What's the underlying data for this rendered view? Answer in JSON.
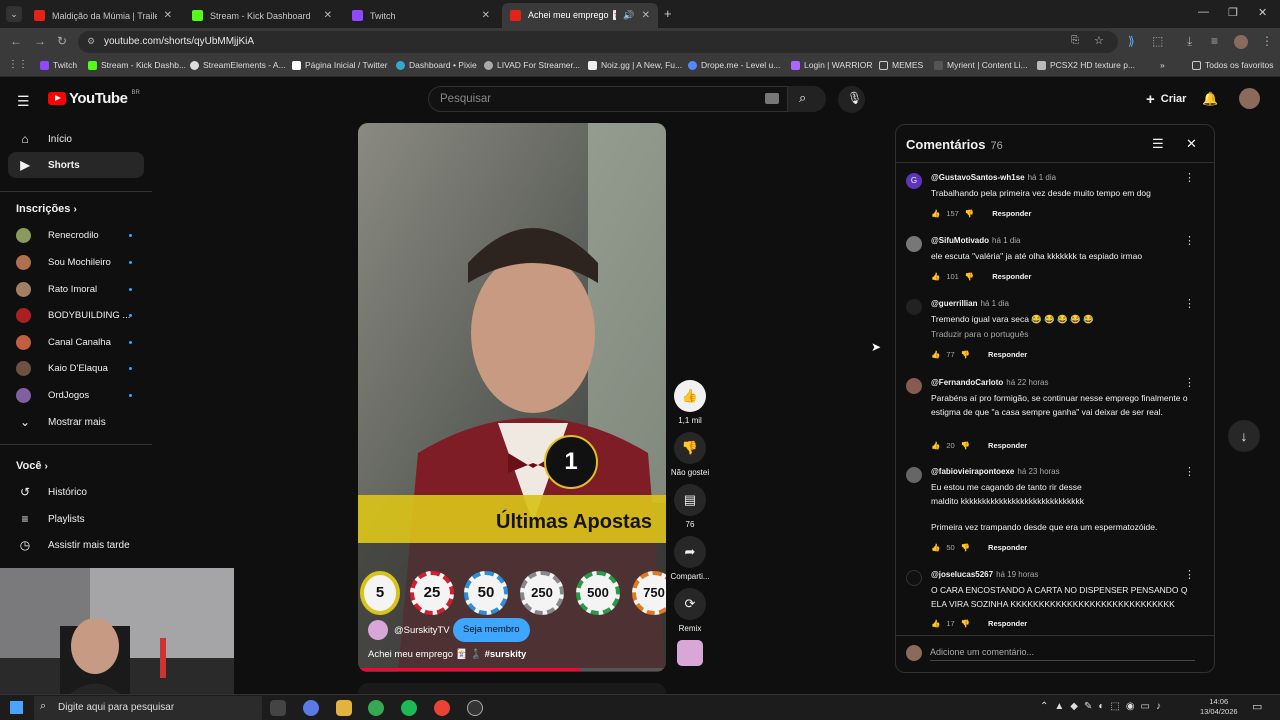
{
  "browser": {
    "tabs": [
      {
        "title": "Maldição da Múmia | Trailer Ofi",
        "color": "#e62117"
      },
      {
        "title": "Stream - Kick Dashboard",
        "color": "#53fc18"
      },
      {
        "title": "Twitch",
        "color": "#9146ff"
      },
      {
        "title": "Achei meu emprego 🃏 ♟️",
        "color": "#e62117"
      }
    ],
    "url": "youtube.com/shorts/qyUbMMjjKiA",
    "bookmarks": [
      "Twitch",
      "Stream - Kick Dashb...",
      "StreamElements - A...",
      "Página Inicial / Twitter",
      "Dashboard • Pixie",
      "LIVAD For Streamer...",
      "Noiz.gg | A New, Fu...",
      "Drope.me - Level u...",
      "Login | WARRIOR",
      "MEMES",
      "Myrient | Content Li...",
      "PCSX2 HD texture p..."
    ],
    "favorites_label": "Todos os favoritos"
  },
  "header": {
    "logo": "YouTube",
    "region": "BR",
    "search_placeholder": "Pesquisar",
    "create_label": "Criar"
  },
  "sidebar": {
    "nav": [
      {
        "label": "Início",
        "icon": "home-icon"
      },
      {
        "label": "Shorts",
        "icon": "shorts-icon"
      }
    ],
    "subscriptions_title": "Inscrições",
    "subscriptions": [
      {
        "name": "Renecrodilo",
        "color": "#8a9a5b"
      },
      {
        "name": "Sou Mochileiro",
        "color": "#b07050"
      },
      {
        "name": "Rato Imoral",
        "color": "#a08060"
      },
      {
        "name": "BODYBUILDING ...",
        "color": "#aa2020"
      },
      {
        "name": "Canal Canalha",
        "color": "#c06040"
      },
      {
        "name": "Kaio D'Elaqua",
        "color": "#705040"
      },
      {
        "name": "OrdJogos",
        "color": "#8060a0"
      }
    ],
    "show_more": "Mostrar mais",
    "you_title": "Você",
    "you_items": [
      {
        "label": "Histórico",
        "icon": "history-icon"
      },
      {
        "label": "Playlists",
        "icon": "playlists-icon"
      },
      {
        "label": "Assistir mais tarde",
        "icon": "watch-later-icon"
      }
    ]
  },
  "short": {
    "overlay_text": "Últimas Apostas",
    "chips": [
      "5",
      "25",
      "50",
      "250",
      "500",
      "750"
    ],
    "counter": "1",
    "channel": "@SurskityTV",
    "member_button": "Seja membro",
    "caption": "Achei meu emprego 🃏 ♟️",
    "hashtag": "#surskity",
    "likes": "1,1 mil",
    "dislike_label": "Não gostei",
    "comments_count": "76",
    "share_label": "Comparti...",
    "remix_label": "Remix"
  },
  "comments": {
    "title": "Comentários",
    "count": "76",
    "reply_label": "Responder",
    "add_placeholder": "Adicione um comentário...",
    "items": [
      {
        "user": "@GustavoSantos-wh1se",
        "time": "há 1 dia",
        "text": "Trabalhando pela primeira vez desde muito tempo em dog",
        "likes": "157",
        "avatar_color": "#5c35b8",
        "avatar_letter": "G"
      },
      {
        "user": "@SifuMotivado",
        "time": "há 1 dia",
        "text": "ele escuta \"valéria\" ja até olha kkkkkkk ta espiado irmao",
        "likes": "101",
        "avatar_color": "#777777",
        "avatar_letter": ""
      },
      {
        "user": "@guerrillian",
        "time": "há 1 dia",
        "text": "Tremendo igual vara seca 😂 😂 😂 😂 😂",
        "translate": "Traduzir para o português",
        "likes": "77",
        "avatar_color": "#222222",
        "avatar_letter": ""
      },
      {
        "user": "@FernandoCarloto",
        "time": "há 22 horas",
        "text": "Parabéns aí pro formigão, se continuar nesse emprego finalmente o estigma de que \"a casa sempre ganha\" vai deixar de ser real.",
        "likes": "20",
        "avatar_color": "#8a5a50",
        "avatar_letter": ""
      },
      {
        "user": "@fabiovieirapontoexe",
        "time": "há 23 horas",
        "text": "Eu estou me cagando de tanto rir desse maldito kkkkkkkkkkkkkkkkkkkkkkkkkkkkk",
        "text2": "Primeira vez trampando desde que era um espermatozóide.",
        "likes": "50",
        "avatar_color": "#666666",
        "avatar_letter": ""
      },
      {
        "user": "@joselucas5267",
        "time": "há 19 horas",
        "text": "O CARA ENCOSTANDO A CARTA NO DISPENSER PENSANDO Q ELA VIRA SOZINHA KKKKKKKKKKKKKKKKKKKKKKKKKKKKK",
        "likes": "17",
        "avatar_color": "#111111",
        "avatar_letter": ""
      }
    ]
  },
  "taskbar": {
    "search_placeholder": "Digite aqui para pesquisar",
    "time": "14:06",
    "date": "13/04/2026"
  }
}
